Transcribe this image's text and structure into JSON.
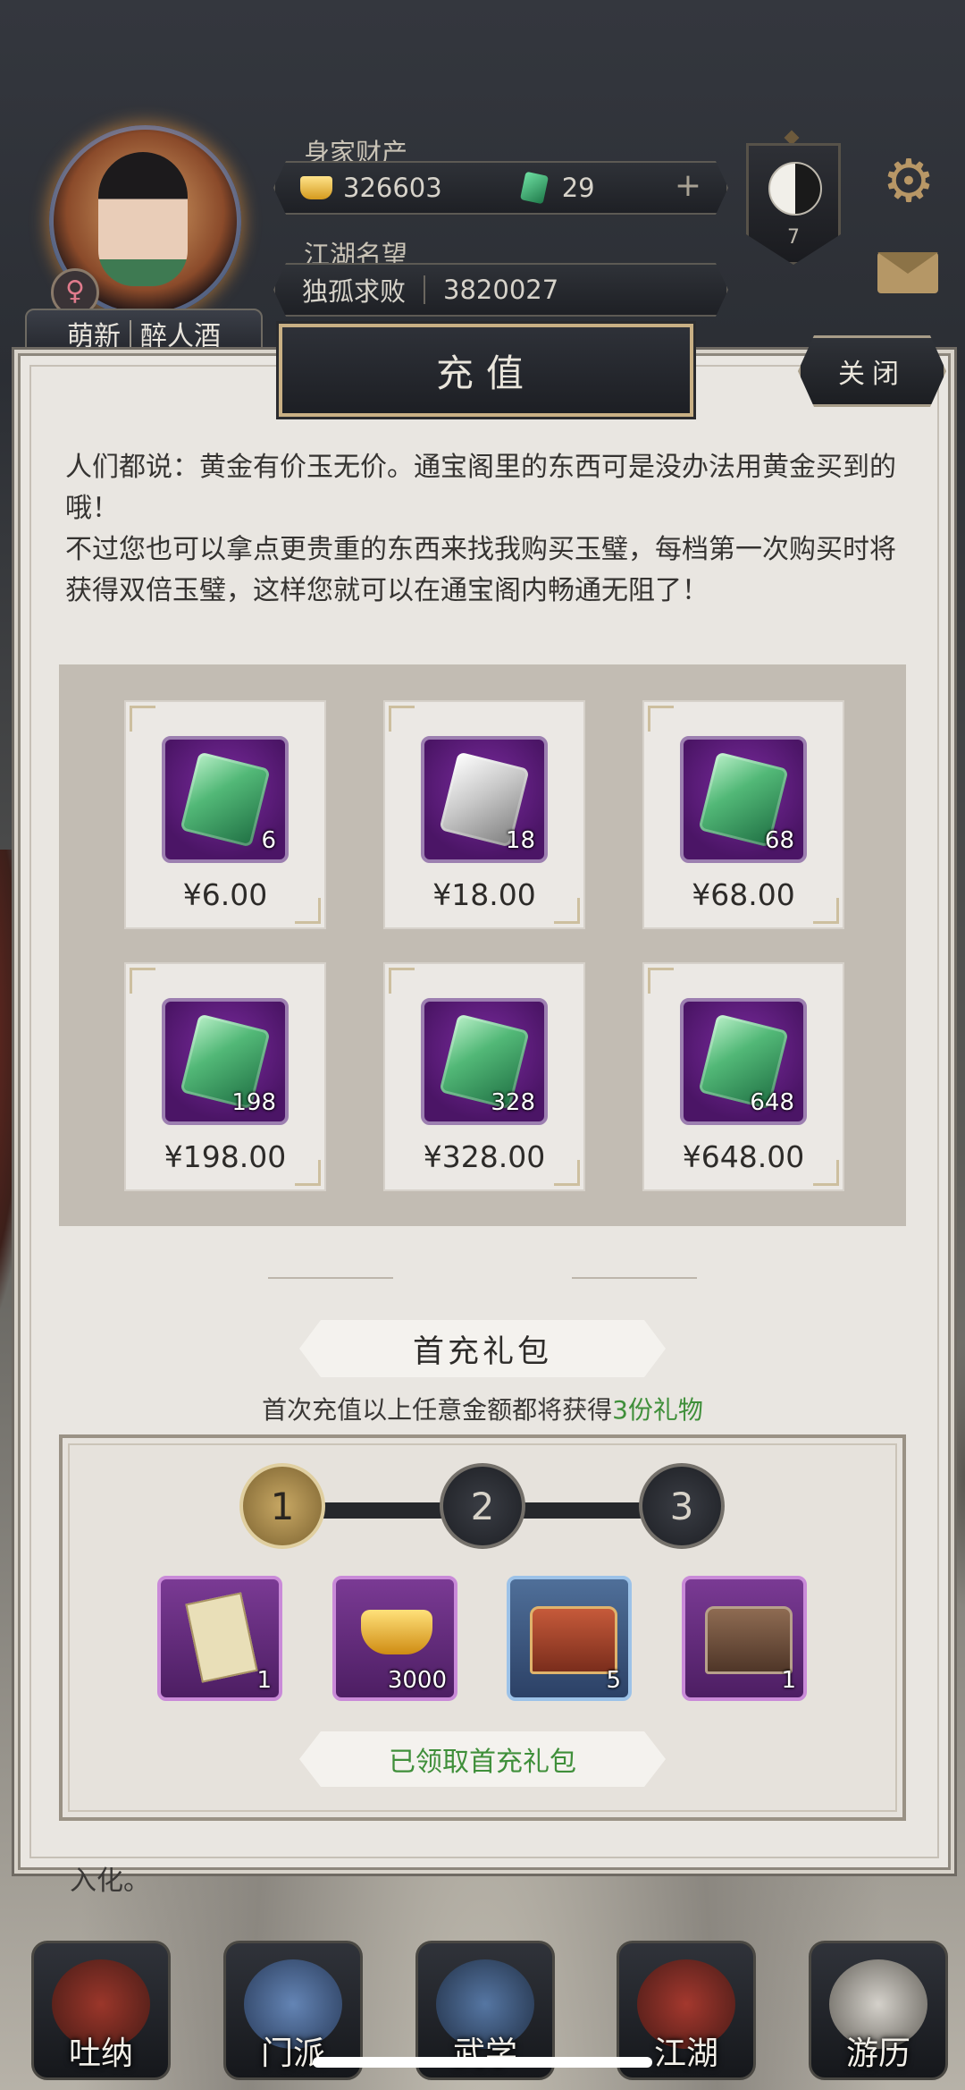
{
  "profile": {
    "gender_symbol": "♀",
    "title": "萌新",
    "name": "醉人酒"
  },
  "wealth": {
    "label": "身家财产",
    "gold": "326603",
    "jade": "29",
    "add_symbol": "+"
  },
  "reputation": {
    "label": "江湖名望",
    "rank": "独孤求败",
    "value": "3820027"
  },
  "badge": {
    "level": "7"
  },
  "dialog": {
    "title": "充值",
    "close_label": "关闭",
    "intro_line1": "人们都说：黄金有价玉无价。通宝阁里的东西可是没办法用黄金买到的哦！",
    "intro_line2": "不过您也可以拿点更贵重的东西来找我购买玉璧，每档第一次购买时将获得双倍玉璧，这样您就可以在通宝阁内畅通无阻了！",
    "tiers": [
      {
        "qty": "6",
        "price": "¥6.00",
        "icon": "green-jade-icon"
      },
      {
        "qty": "18",
        "price": "¥18.00",
        "icon": "silver-jade-icon"
      },
      {
        "qty": "68",
        "price": "¥68.00",
        "icon": "green-jade-icon"
      },
      {
        "qty": "198",
        "price": "¥198.00",
        "icon": "green-jade-icon"
      },
      {
        "qty": "328",
        "price": "¥328.00",
        "icon": "green-jade-icon"
      },
      {
        "qty": "648",
        "price": "¥648.00",
        "icon": "green-jade-icon"
      }
    ]
  },
  "first_gift": {
    "title": "首充礼包",
    "subtitle_prefix": "首次充值以上任意金额都将获得",
    "subtitle_highlight": "3份礼物",
    "steps": [
      "1",
      "2",
      "3"
    ],
    "items": [
      {
        "icon": "book-icon",
        "qty": "1"
      },
      {
        "icon": "gold-ingot-icon",
        "qty": "3000"
      },
      {
        "icon": "red-chest-icon",
        "qty": "5"
      },
      {
        "icon": "wood-chest-icon",
        "qty": "1"
      }
    ],
    "claimed_label": "已领取首充礼包",
    "accent": "#3f8f3a"
  },
  "behind_text": "入化。",
  "nav": {
    "items": [
      {
        "label": "吐纳"
      },
      {
        "label": "门派"
      },
      {
        "label": "武学"
      },
      {
        "label": "江湖"
      },
      {
        "label": "游历"
      }
    ]
  }
}
